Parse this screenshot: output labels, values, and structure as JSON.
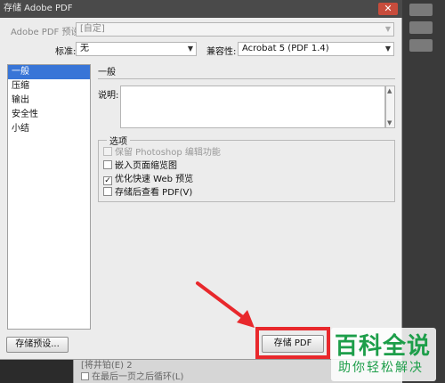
{
  "window": {
    "title": "存储 Adobe PDF",
    "close_glyph": "✕"
  },
  "top_fields": {
    "preset_label": "Adobe PDF 预设:",
    "preset_value": "[自定]",
    "standard_label": "标准:",
    "standard_value": "无",
    "compat_label": "兼容性:",
    "compat_value": "Acrobat 5 (PDF 1.4)"
  },
  "sidebar": {
    "items": [
      {
        "label": "一般",
        "selected": true
      },
      {
        "label": "压缩",
        "selected": false
      },
      {
        "label": "输出",
        "selected": false
      },
      {
        "label": "安全性",
        "selected": false
      },
      {
        "label": "小结",
        "selected": false
      }
    ]
  },
  "general": {
    "section_title": "一般",
    "description_label": "说明:",
    "description_value": ""
  },
  "options": {
    "legend": "选项",
    "items": [
      {
        "label": "保留 Photoshop 编辑功能",
        "checked": false,
        "disabled": true
      },
      {
        "label": "嵌入页面缩览图",
        "checked": false,
        "disabled": false
      },
      {
        "label": "优化快速 Web 预览",
        "checked": true,
        "disabled": false
      },
      {
        "label": "存储后查看 PDF(V)",
        "checked": false,
        "disabled": false
      }
    ]
  },
  "buttons": {
    "save_preset": "存储预设...",
    "save_pdf": "存储 PDF"
  },
  "background_dialog": {
    "line1": "[将井铂(E)   2",
    "line2": "在最后一页之后循环(L)"
  },
  "watermark": {
    "main": "百科全说",
    "sub": "助你轻松解决"
  },
  "colors": {
    "selection": "#3875d7",
    "annotation_red": "#e8282c",
    "watermark_green": "#1d9e4a"
  }
}
